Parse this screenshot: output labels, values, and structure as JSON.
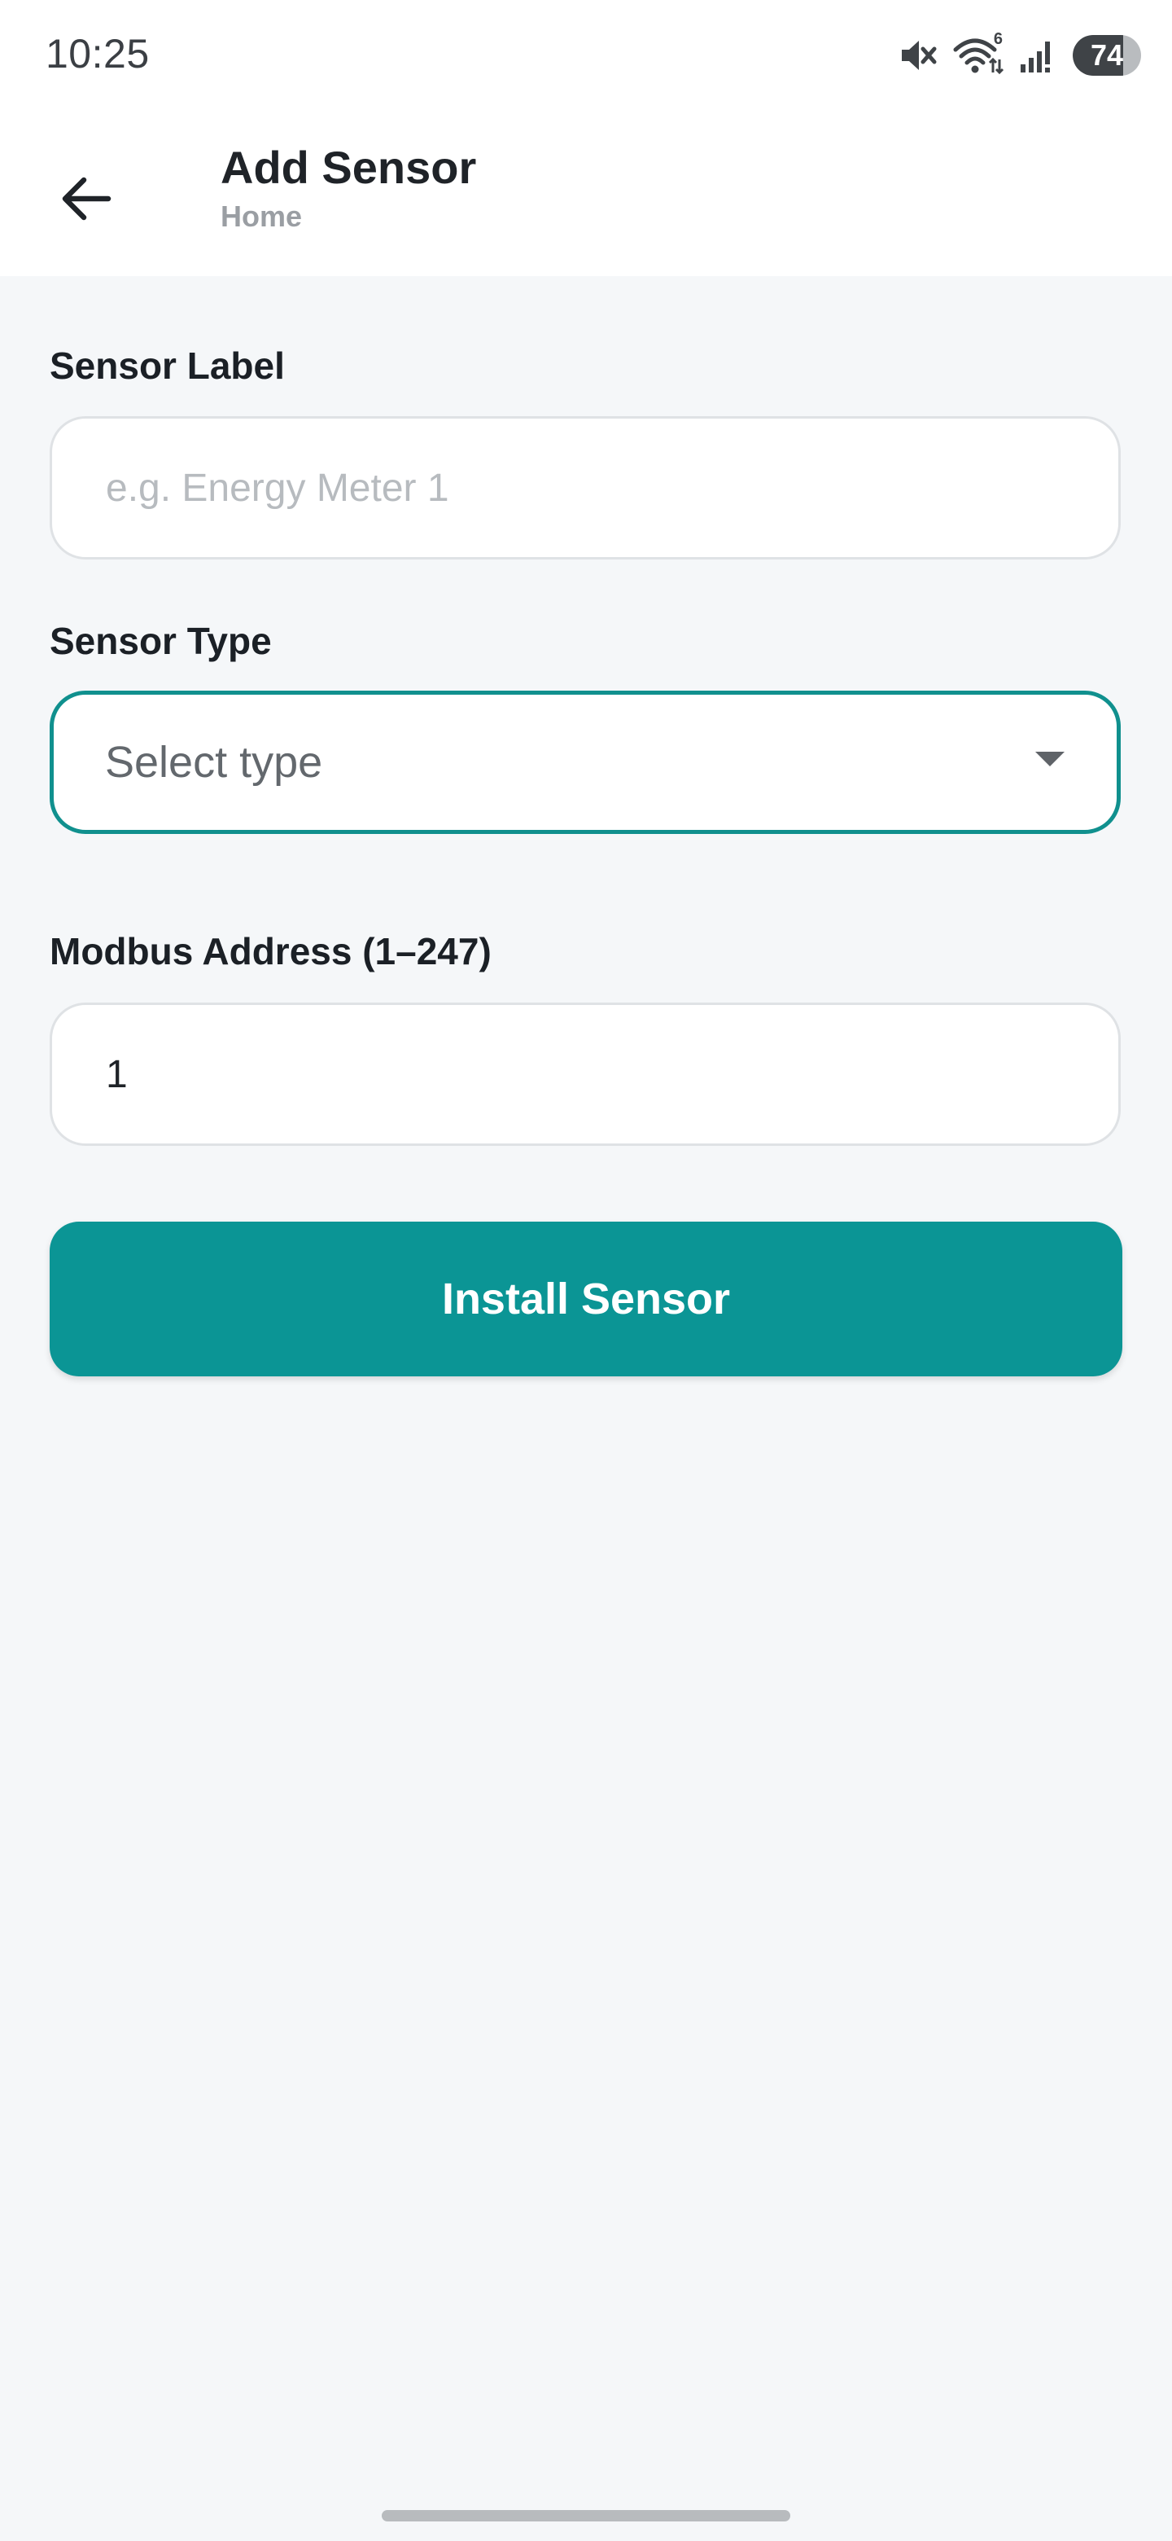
{
  "status_bar": {
    "time": "10:25",
    "battery_level": "74",
    "battery_fraction": 0.74,
    "wifi_badge": "6",
    "icons": [
      "mute-icon",
      "wifi-icon",
      "signal-icon",
      "battery-icon"
    ]
  },
  "app_bar": {
    "title": "Add Sensor",
    "subtitle": "Home",
    "back_icon": "arrow-left-icon"
  },
  "form": {
    "sensor_label": {
      "label": "Sensor Label",
      "value": "",
      "placeholder": "e.g. Energy Meter 1"
    },
    "sensor_type": {
      "label": "Sensor Type",
      "selected": "Select type",
      "icon": "caret-down-icon"
    },
    "modbus_address": {
      "label": "Modbus Address (1–247)",
      "value": "1"
    },
    "submit_label": "Install Sensor"
  },
  "colors": {
    "accent": "#0b9595",
    "select_border": "#10908e",
    "background": "#f5f7f9",
    "surface": "#ffffff"
  }
}
